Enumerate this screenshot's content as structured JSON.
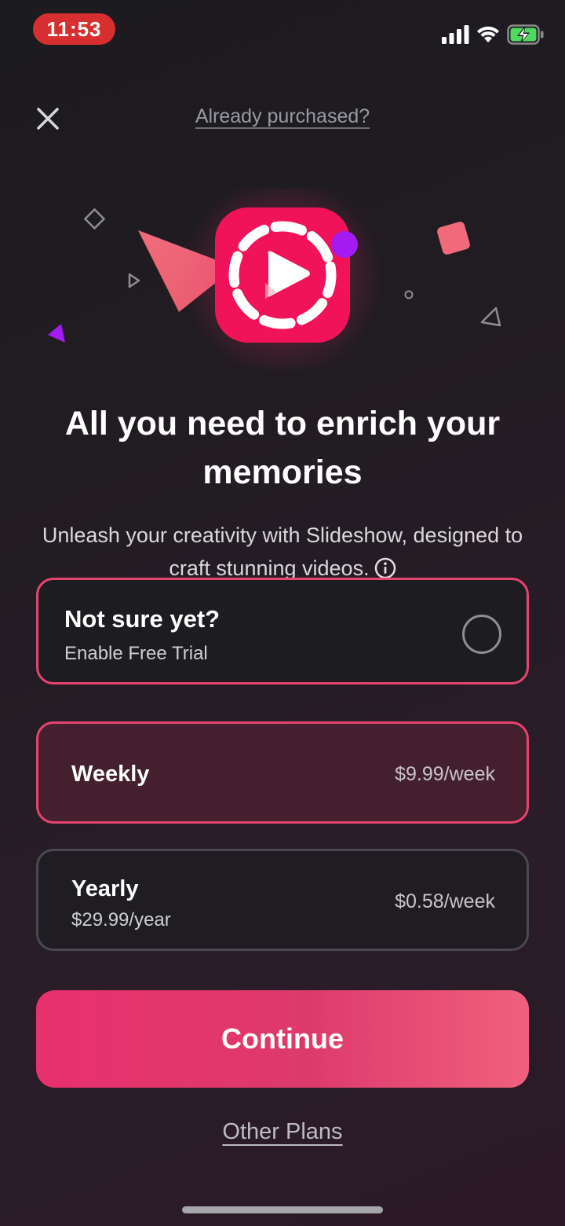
{
  "status_bar": {
    "time": "11:53",
    "icons": [
      "signal-icon",
      "wifi-icon",
      "battery-charging-icon"
    ],
    "time_pill_color": "#d72f2f"
  },
  "nav": {
    "close_icon": "close-icon",
    "already_purchased": "Already purchased?"
  },
  "hero": {
    "app_icon": "slideshow-play-icon",
    "accent": "#f0135a"
  },
  "headline": {
    "title": "All you need to enrich your memories",
    "subtitle": "Unleash your creativity with Slideshow, designed to craft stunning videos.",
    "info_icon": "info-icon"
  },
  "plans": {
    "trial": {
      "title": "Not sure yet?",
      "subtitle": "Enable Free Trial",
      "selected": false
    },
    "weekly": {
      "name": "Weekly",
      "price": "$9.99/week",
      "selected": true
    },
    "yearly": {
      "name": "Yearly",
      "sub_price": "$29.99/year",
      "price": "$0.58/week",
      "selected": false
    }
  },
  "cta": {
    "continue_label": "Continue",
    "other_plans": "Other Plans"
  },
  "colors": {
    "accent_border": "#e5446f",
    "selected_card_bg": "#44202f",
    "button_gradient_start": "#e8306e",
    "button_gradient_end": "#f0607d"
  }
}
